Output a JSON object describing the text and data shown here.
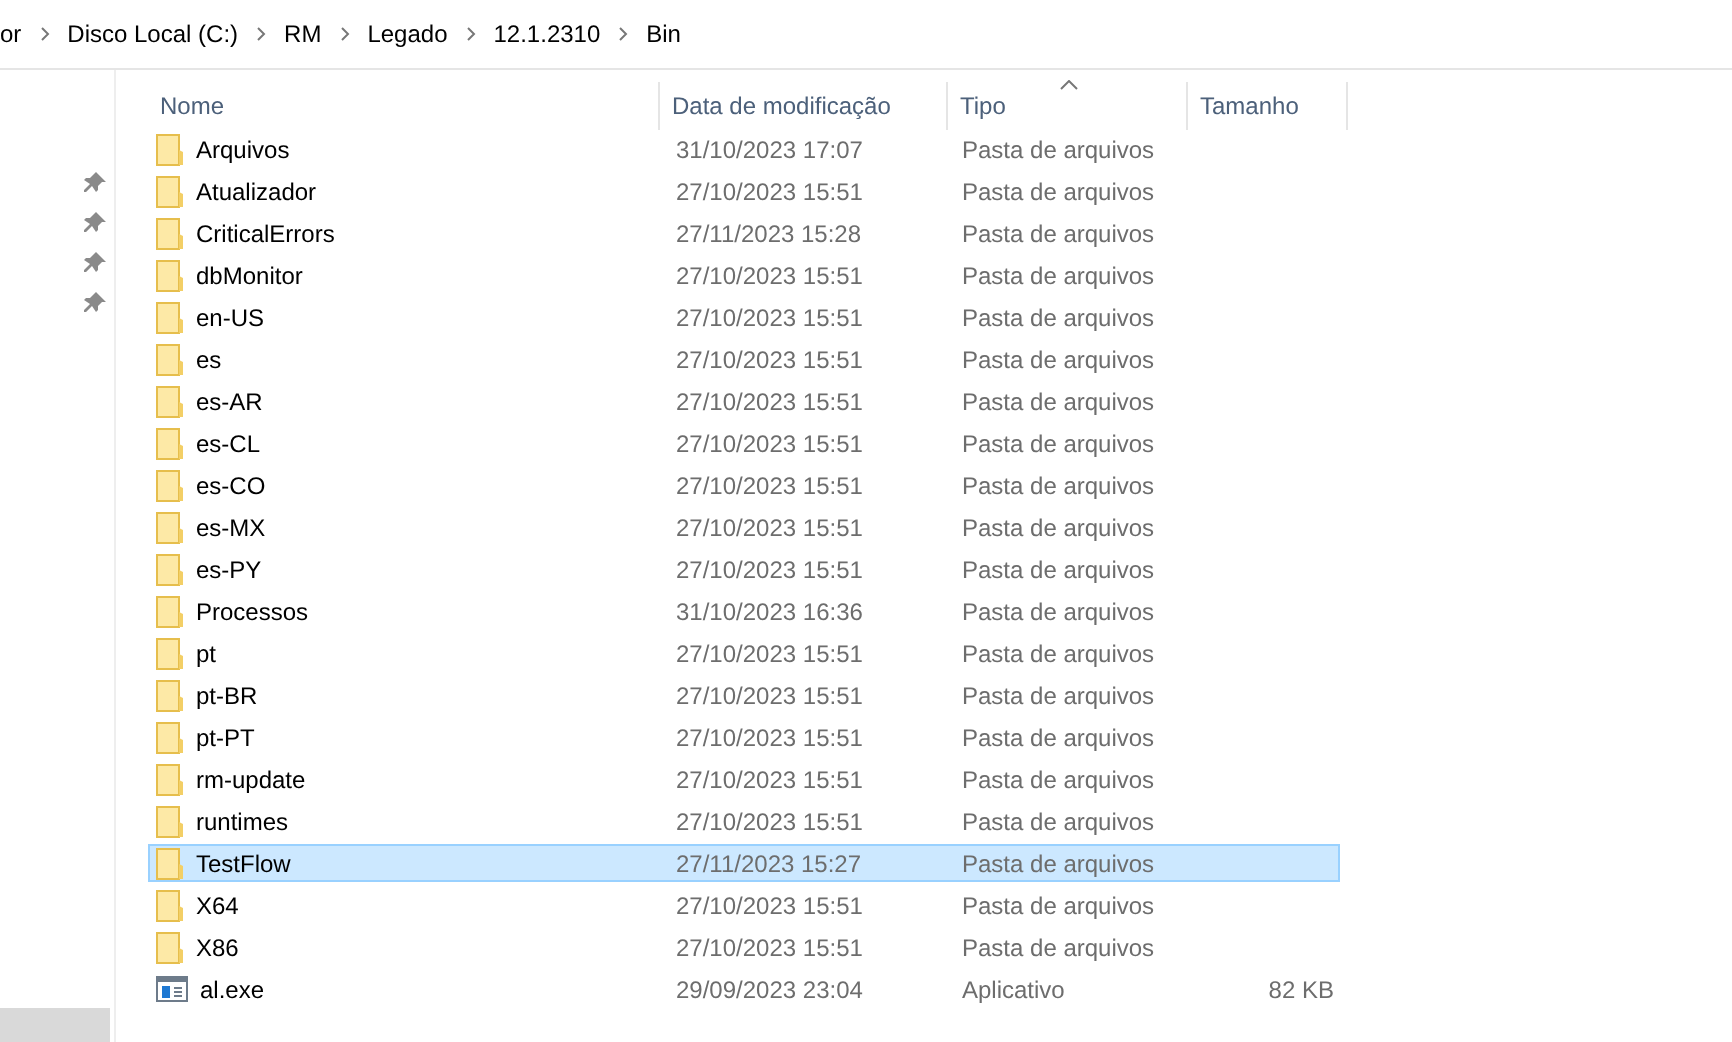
{
  "breadcrumb": [
    "or",
    "Disco Local (C:)",
    "RM",
    "Legado",
    "12.1.2310",
    "Bin"
  ],
  "columns": [
    {
      "label": "Nome",
      "sorted": false
    },
    {
      "label": "Data de modificação",
      "sorted": false
    },
    {
      "label": "Tipo",
      "sorted": true
    },
    {
      "label": "Tamanho",
      "sorted": false
    }
  ],
  "files": [
    {
      "kind": "folder",
      "name": "Arquivos",
      "date": "31/10/2023 17:07",
      "type": "Pasta de arquivos",
      "selected": false
    },
    {
      "kind": "folder",
      "name": "Atualizador",
      "date": "27/10/2023 15:51",
      "type": "Pasta de arquivos",
      "selected": false
    },
    {
      "kind": "folder",
      "name": "CriticalErrors",
      "date": "27/11/2023 15:28",
      "type": "Pasta de arquivos",
      "selected": false
    },
    {
      "kind": "folder",
      "name": "dbMonitor",
      "date": "27/10/2023 15:51",
      "type": "Pasta de arquivos",
      "selected": false
    },
    {
      "kind": "folder",
      "name": "en-US",
      "date": "27/10/2023 15:51",
      "type": "Pasta de arquivos",
      "selected": false
    },
    {
      "kind": "folder",
      "name": "es",
      "date": "27/10/2023 15:51",
      "type": "Pasta de arquivos",
      "selected": false
    },
    {
      "kind": "folder",
      "name": "es-AR",
      "date": "27/10/2023 15:51",
      "type": "Pasta de arquivos",
      "selected": false
    },
    {
      "kind": "folder",
      "name": "es-CL",
      "date": "27/10/2023 15:51",
      "type": "Pasta de arquivos",
      "selected": false
    },
    {
      "kind": "folder",
      "name": "es-CO",
      "date": "27/10/2023 15:51",
      "type": "Pasta de arquivos",
      "selected": false
    },
    {
      "kind": "folder",
      "name": "es-MX",
      "date": "27/10/2023 15:51",
      "type": "Pasta de arquivos",
      "selected": false
    },
    {
      "kind": "folder",
      "name": "es-PY",
      "date": "27/10/2023 15:51",
      "type": "Pasta de arquivos",
      "selected": false
    },
    {
      "kind": "folder",
      "name": "Processos",
      "date": "31/10/2023 16:36",
      "type": "Pasta de arquivos",
      "selected": false
    },
    {
      "kind": "folder",
      "name": "pt",
      "date": "27/10/2023 15:51",
      "type": "Pasta de arquivos",
      "selected": false
    },
    {
      "kind": "folder",
      "name": "pt-BR",
      "date": "27/10/2023 15:51",
      "type": "Pasta de arquivos",
      "selected": false
    },
    {
      "kind": "folder",
      "name": "pt-PT",
      "date": "27/10/2023 15:51",
      "type": "Pasta de arquivos",
      "selected": false
    },
    {
      "kind": "folder",
      "name": "rm-update",
      "date": "27/10/2023 15:51",
      "type": "Pasta de arquivos",
      "selected": false
    },
    {
      "kind": "folder",
      "name": "runtimes",
      "date": "27/10/2023 15:51",
      "type": "Pasta de arquivos",
      "selected": false
    },
    {
      "kind": "folder",
      "name": "TestFlow",
      "date": "27/11/2023 15:27",
      "type": "Pasta de arquivos",
      "selected": true
    },
    {
      "kind": "folder",
      "name": "X64",
      "date": "27/10/2023 15:51",
      "type": "Pasta de arquivos",
      "selected": false
    },
    {
      "kind": "folder",
      "name": "X86",
      "date": "27/10/2023 15:51",
      "type": "Pasta de arquivos",
      "selected": false
    },
    {
      "kind": "app",
      "name": "al.exe",
      "date": "29/09/2023 23:04",
      "type": "Aplicativo",
      "size": "82 KB",
      "selected": false
    }
  ]
}
